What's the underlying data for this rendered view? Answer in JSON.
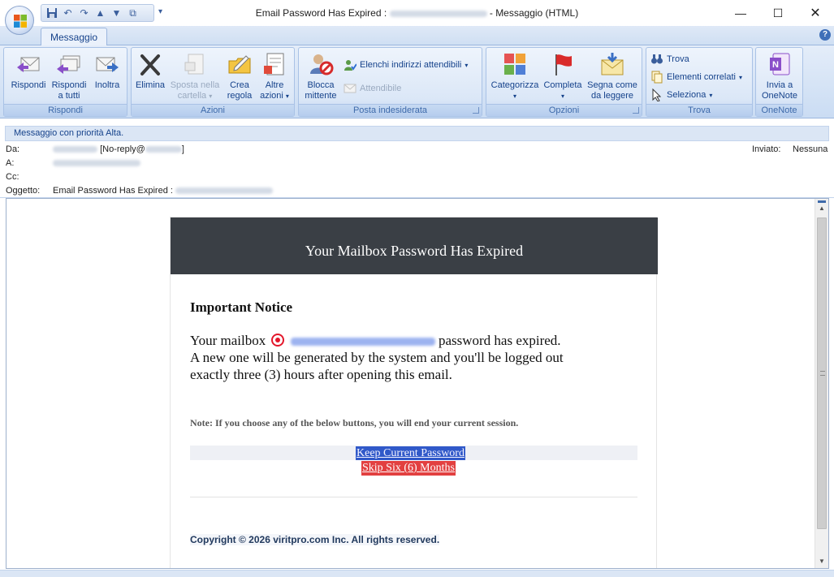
{
  "window": {
    "title_prefix": "Email Password Has Expired :",
    "title_suffix": "- Messaggio (HTML)"
  },
  "ribbon": {
    "tab": "Messaggio",
    "groups": {
      "rispondi": "Rispondi",
      "azioni": "Azioni",
      "posta": "Posta indesiderata",
      "opzioni": "Opzioni",
      "trova": "Trova",
      "onenote": "OneNote"
    },
    "buttons": {
      "rispondi": "Rispondi",
      "rispondi_tutti_1": "Rispondi",
      "rispondi_tutti_2": "a tutti",
      "inoltra": "Inoltra",
      "elimina": "Elimina",
      "sposta_1": "Sposta nella",
      "sposta_2": "cartella",
      "crea_1": "Crea",
      "crea_2": "regola",
      "altre_1": "Altre",
      "altre_2": "azioni",
      "blocca_1": "Blocca",
      "blocca_2": "mittente",
      "elenchi": "Elenchi indirizzi attendibili",
      "attendibile": "Attendibile",
      "categorizza": "Categorizza",
      "completa": "Completa",
      "segna_1": "Segna come",
      "segna_2": "da leggere",
      "trova": "Trova",
      "elementi": "Elementi correlati",
      "seleziona": "Seleziona",
      "invia_1": "Invia a",
      "invia_2": "OneNote"
    }
  },
  "header": {
    "priority": "Messaggio con priorità Alta.",
    "da_label": "Da:",
    "da_value": "[No-reply@",
    "da_end": "]",
    "a_label": "A:",
    "cc_label": "Cc:",
    "oggetto_label": "Oggetto:",
    "oggetto_value": "Email Password Has Expired :",
    "inviato_label": "Inviato:",
    "inviato_value": "Nessuna"
  },
  "email": {
    "banner": "Your Mailbox Password Has Expired",
    "notice": "Important Notice",
    "line1_a": "Your mailbox",
    "line1_b": "password has expired.",
    "line2": "A new one will be generated by the system and you'll be logged out",
    "line3": "exactly three (3) hours after opening this email.",
    "note": "Note: If you choose any of the below buttons, you will end your current session.",
    "keep_button": "Keep Current Password",
    "skip_button": "Skip Six (6) Months",
    "copyright": "Copyright © 2026  viritpro.com  Inc. All rights reserved."
  },
  "colors": {
    "banner": "#3a3f45",
    "keep_button": "#3059c9",
    "skip_button": "#e24040",
    "warning_icon": "#e3172b",
    "ribbon_text": "#15428b"
  }
}
